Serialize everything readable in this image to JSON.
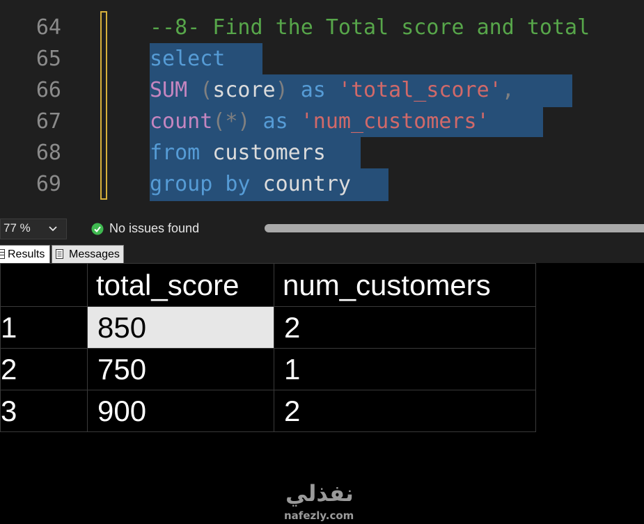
{
  "editor": {
    "line_numbers": [
      "64",
      "65",
      "66",
      "67",
      "68",
      "69"
    ],
    "lines": [
      [
        {
          "t": "--8- Find the Total score and total",
          "k": "comment"
        }
      ],
      [
        {
          "t": "select",
          "k": "kw"
        }
      ],
      [
        {
          "t": "SUM",
          "k": "fn"
        },
        {
          "t": " ",
          "k": "id"
        },
        {
          "t": "(",
          "k": "punc"
        },
        {
          "t": "score",
          "k": "id"
        },
        {
          "t": ")",
          "k": "punc"
        },
        {
          "t": " as ",
          "k": "kw"
        },
        {
          "t": "'total_score'",
          "k": "str"
        },
        {
          "t": ",",
          "k": "punc"
        }
      ],
      [
        {
          "t": "count",
          "k": "fn"
        },
        {
          "t": "(*)",
          "k": "punc"
        },
        {
          "t": " as ",
          "k": "kw"
        },
        {
          "t": "'num_customers'",
          "k": "str"
        }
      ],
      [
        {
          "t": "from",
          "k": "kw"
        },
        {
          "t": " customers",
          "k": "id"
        }
      ],
      [
        {
          "t": "group by",
          "k": "kw"
        },
        {
          "t": " country",
          "k": "id"
        }
      ]
    ]
  },
  "statusbar": {
    "zoom": "77 %",
    "issues": "No issues found"
  },
  "tabs": {
    "results": "Results",
    "messages": "Messages"
  },
  "grid": {
    "columns": [
      "total_score",
      "num_customers"
    ],
    "rows": [
      {
        "num": "1",
        "total_score": "850",
        "num_customers": "2"
      },
      {
        "num": "2",
        "total_score": "750",
        "num_customers": "1"
      },
      {
        "num": "3",
        "total_score": "900",
        "num_customers": "2"
      }
    ]
  },
  "watermark": {
    "arabic": "نفذلي",
    "latin": "nafezly.com"
  },
  "colors": {
    "comment": "#57a64a",
    "keyword": "#569cd6",
    "function": "#c586c0",
    "string": "#d16969",
    "selection": "#264f78",
    "change_bar": "#d7b03c"
  }
}
